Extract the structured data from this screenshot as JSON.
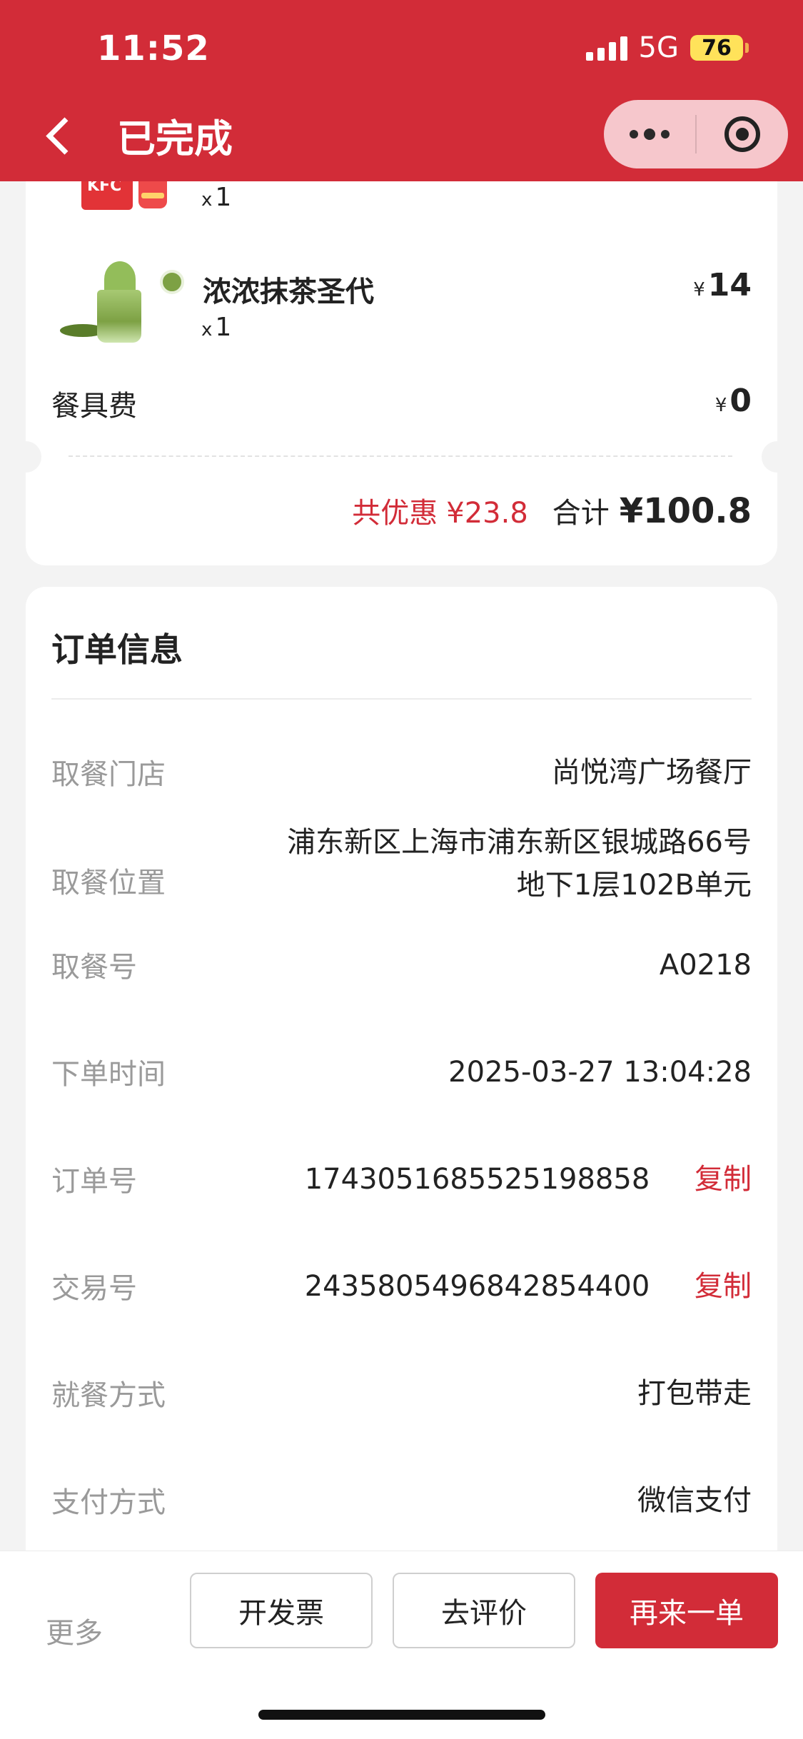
{
  "status_bar": {
    "time": "11:52",
    "network": "5G",
    "battery": "76"
  },
  "nav": {
    "title": "已完成"
  },
  "order_items": {
    "partial_item": {
      "qty": "1"
    },
    "item": {
      "name": "浓浓抹茶圣代",
      "qty": "1",
      "currency": "¥",
      "price": "14"
    },
    "utensil_fee": {
      "label": "餐具费",
      "currency": "¥",
      "price": "0"
    },
    "discount": {
      "label": "共优惠",
      "value": "¥23.8"
    },
    "total": {
      "label": "合计",
      "value": "¥100.8"
    }
  },
  "order_info": {
    "title": "订单信息",
    "rows": [
      {
        "label": "取餐门店",
        "value": "尚悦湾广场餐厅"
      },
      {
        "label": "取餐位置",
        "value_line1": "浦东新区上海市浦东新区银城路66号",
        "value_line2": "地下1层102B单元"
      },
      {
        "label": "取餐号",
        "value": "A0218"
      },
      {
        "label": "下单时间",
        "value": "2025-03-27 13:04:28"
      },
      {
        "label": "订单号",
        "value": "1743051685525198858",
        "action": "复制"
      },
      {
        "label": "交易号",
        "value": "2435805496842854400",
        "action": "复制"
      },
      {
        "label": "就餐方式",
        "value": "打包带走"
      },
      {
        "label": "支付方式",
        "value": "微信支付"
      }
    ]
  },
  "actions": {
    "more": "更多",
    "invoice": "开发票",
    "review": "去评价",
    "reorder": "再来一单"
  },
  "colors": {
    "brand_red": "#d22c38"
  }
}
